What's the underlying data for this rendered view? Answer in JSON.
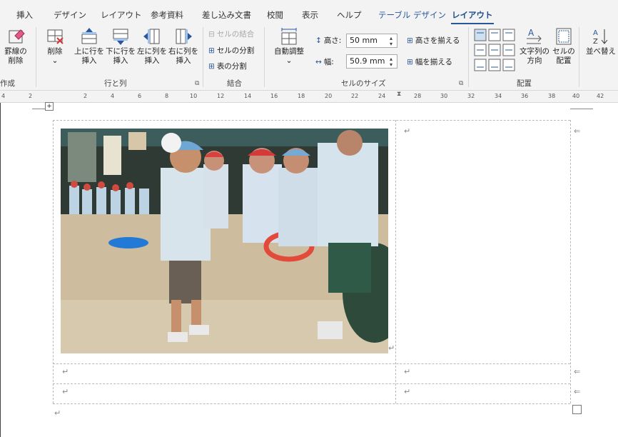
{
  "tabs": [
    {
      "label": "挿入"
    },
    {
      "label": "デザイン"
    },
    {
      "label": "レイアウト"
    },
    {
      "label": "参考資料"
    },
    {
      "label": "差し込み文書"
    },
    {
      "label": "校閲"
    },
    {
      "label": "表示"
    },
    {
      "label": "ヘルプ"
    },
    {
      "label": "テーブル デザイン"
    },
    {
      "label": "レイアウト"
    }
  ],
  "ribbon": {
    "draw": {
      "erase_line1": "罫線の",
      "erase_line2": "削除",
      "group": "作成"
    },
    "rows_cols": {
      "delete": "削除",
      "insert_above_1": "上に行を",
      "insert_above_2": "挿入",
      "insert_below_1": "下に行を",
      "insert_below_2": "挿入",
      "insert_left_1": "左に列を",
      "insert_left_2": "挿入",
      "insert_right_1": "右に列を",
      "insert_right_2": "挿入",
      "group": "行と列"
    },
    "merge": {
      "merge_cells": "セルの結合",
      "split_cells": "セルの分割",
      "split_table": "表の分割",
      "group": "結合"
    },
    "cell_size": {
      "autofit": "自動調整",
      "height_label": "高さ:",
      "height_value": "50 mm",
      "width_label": "幅:",
      "width_value": "50.9 mm",
      "dist_rows": "高さを揃える",
      "dist_cols": "幅を揃える",
      "group": "セルのサイズ"
    },
    "alignment": {
      "text_dir_1": "文字列の",
      "text_dir_2": "方向",
      "margins_1": "セルの",
      "margins_2": "配置",
      "group": "配置"
    },
    "data": {
      "sort": "並べ替え"
    }
  },
  "ruler": [
    "4",
    "2",
    "2",
    "4",
    "6",
    "8",
    "10",
    "12",
    "14",
    "16",
    "18",
    "20",
    "22",
    "24",
    "28",
    "30",
    "32",
    "34",
    "36",
    "38",
    "40",
    "42"
  ],
  "document": {
    "return_mark": "↵",
    "end_mark": "⇐"
  },
  "colors": {
    "accent": "#2b579a",
    "ribbon_bg": "#f3f3f3"
  }
}
